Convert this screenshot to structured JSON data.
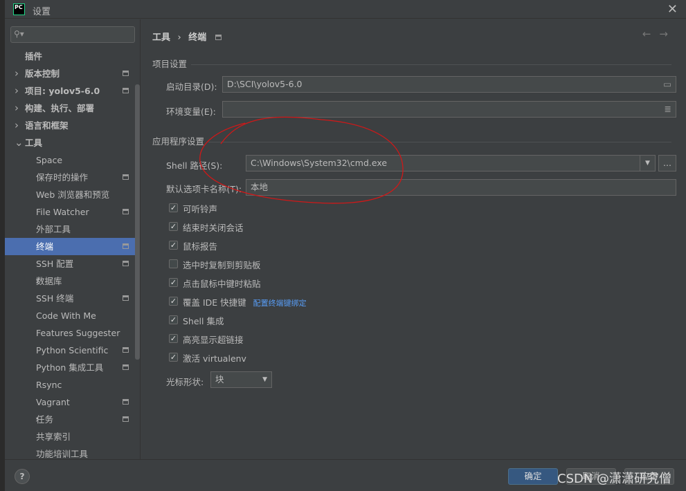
{
  "window": {
    "title": "设置",
    "logo": "PC"
  },
  "sidebar": {
    "items": [
      {
        "label": "插件",
        "bold": true,
        "depth": 0
      },
      {
        "label": "版本控制",
        "bold": true,
        "depth": 0,
        "arrow": "right",
        "project": true
      },
      {
        "label": "项目: yolov5-6.0",
        "bold": true,
        "depth": 0,
        "arrow": "right",
        "project": true
      },
      {
        "label": "构建、执行、部署",
        "bold": true,
        "depth": 0,
        "arrow": "right"
      },
      {
        "label": "语言和框架",
        "bold": true,
        "depth": 0,
        "arrow": "right"
      },
      {
        "label": "工具",
        "bold": true,
        "depth": 0,
        "arrow": "down"
      },
      {
        "label": "Space",
        "depth": 1
      },
      {
        "label": "保存时的操作",
        "depth": 1,
        "project": true
      },
      {
        "label": "Web 浏览器和预览",
        "depth": 1
      },
      {
        "label": "File Watcher",
        "depth": 1,
        "project": true
      },
      {
        "label": "外部工具",
        "depth": 1
      },
      {
        "label": "终端",
        "depth": 1,
        "project": true,
        "selected": true
      },
      {
        "label": "SSH 配置",
        "depth": 1,
        "project": true
      },
      {
        "label": "数据库",
        "depth": 1,
        "arrow": "right"
      },
      {
        "label": "SSH 终端",
        "depth": 1,
        "project": true
      },
      {
        "label": "Code With Me",
        "depth": 1
      },
      {
        "label": "Features Suggester",
        "depth": 1
      },
      {
        "label": "Python Scientific",
        "depth": 1,
        "project": true
      },
      {
        "label": "Python 集成工具",
        "depth": 1,
        "project": true
      },
      {
        "label": "Rsync",
        "depth": 1
      },
      {
        "label": "Vagrant",
        "depth": 1,
        "project": true
      },
      {
        "label": "任务",
        "depth": 1,
        "arrow": "right",
        "project": true
      },
      {
        "label": "共享索引",
        "depth": 1
      },
      {
        "label": "功能培训工具",
        "depth": 1
      }
    ]
  },
  "breadcrumb": {
    "parent": "工具",
    "sep": "›",
    "current": "终端"
  },
  "project_settings": {
    "title": "项目设置",
    "start_dir_label": "启动目录(D):",
    "start_dir_value": "D:\\SCI\\yolov5-6.0",
    "env_label": "环境变量(E):",
    "env_value": ""
  },
  "app_settings": {
    "title": "应用程序设置",
    "shell_label": "Shell 路径(S):",
    "shell_value": "C:\\Windows\\System32\\cmd.exe",
    "browse_label": "...",
    "tab_name_label": "默认选项卡名称(T):",
    "tab_name_value": "本地",
    "checkboxes": [
      {
        "label": "可听铃声",
        "checked": true
      },
      {
        "label": "结束时关闭会话",
        "checked": true
      },
      {
        "label": "鼠标报告",
        "checked": true
      },
      {
        "label": "选中时复制到剪贴板",
        "checked": false
      },
      {
        "label": "点击鼠标中键时粘贴",
        "checked": true
      },
      {
        "label": "覆盖 IDE 快捷键",
        "checked": true,
        "link": "配置终端键绑定"
      },
      {
        "label": "Shell 集成",
        "checked": true
      },
      {
        "label": "高亮显示超链接",
        "checked": true
      },
      {
        "label": "激活 virtualenv",
        "checked": true
      }
    ],
    "cursor_label": "光标形状:",
    "cursor_value": "块"
  },
  "buttons": {
    "ok": "确定",
    "cancel": "取消",
    "apply": "应用",
    "help": "?"
  },
  "annotation_color": "#d01818",
  "watermark": "CSDN @潇潇研究僧"
}
